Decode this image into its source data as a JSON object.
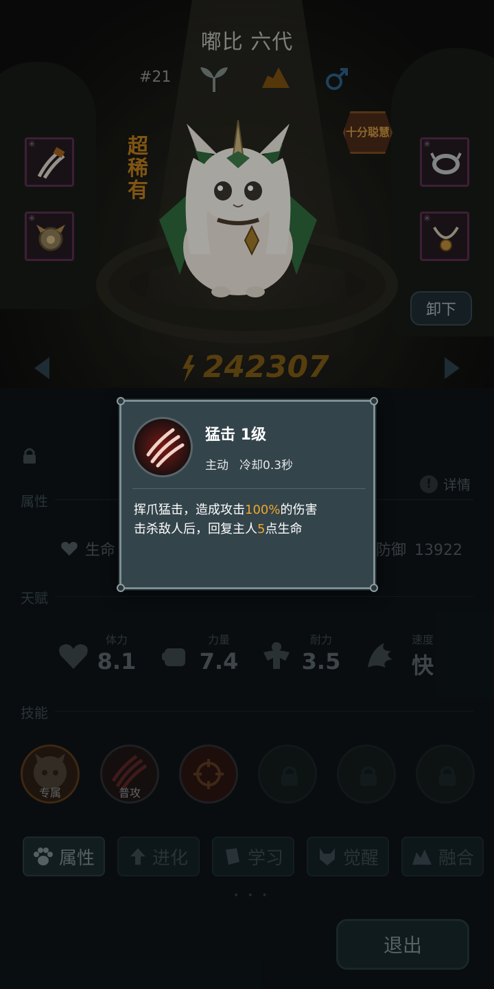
{
  "pet": {
    "name": "嘟比 六代",
    "number": "#21",
    "rarity": "超稀有",
    "wisdom_badge": "十分聪慧",
    "power": "242307",
    "unequip_label": "卸下",
    "icons": [
      "sprout-icon",
      "terrain-icon",
      "male-icon"
    ]
  },
  "equipment": {
    "slots": [
      {
        "name": "claw-equip",
        "icon": "claw-icon"
      },
      {
        "name": "helmet-equip",
        "icon": "helmet-icon"
      },
      {
        "name": "ring-equip",
        "icon": "ring-icon"
      },
      {
        "name": "necklace-equip",
        "icon": "necklace-icon"
      }
    ]
  },
  "detail_label": "详情",
  "sections": {
    "attributes": "属性",
    "talent": "天赋",
    "skills": "技能"
  },
  "attributes": {
    "life_label": "生命",
    "defense_label": "防御",
    "defense_value": "13922"
  },
  "talents": [
    {
      "label": "体力",
      "value": "8.1",
      "icon": "heart-icon"
    },
    {
      "label": "力量",
      "value": "7.4",
      "icon": "fist-icon"
    },
    {
      "label": "耐力",
      "value": "3.5",
      "icon": "muscle-icon"
    },
    {
      "label": "速度",
      "value": "快",
      "icon": "wing-icon"
    }
  ],
  "skills": [
    {
      "tag": "专属",
      "icon": "exclusive-skill-icon",
      "locked": false
    },
    {
      "tag": "普攻",
      "icon": "claw-strike-icon",
      "locked": false
    },
    {
      "tag": "",
      "icon": "target-icon",
      "locked": false
    },
    {
      "tag": "",
      "icon": "lock-icon",
      "locked": true
    },
    {
      "tag": "",
      "icon": "lock-icon",
      "locked": true
    },
    {
      "tag": "",
      "icon": "lock-icon",
      "locked": true
    }
  ],
  "tabs": [
    {
      "label": "属性",
      "icon": "paw-icon",
      "active": true
    },
    {
      "label": "进化",
      "icon": "arrow-up-icon",
      "active": false
    },
    {
      "label": "学习",
      "icon": "book-icon",
      "active": false
    },
    {
      "label": "觉醒",
      "icon": "awaken-icon",
      "active": false
    },
    {
      "label": "融合",
      "icon": "fusion-icon",
      "active": false
    }
  ],
  "pager_dots": "• • •",
  "exit_label": "退出",
  "popup": {
    "title": "猛击 1级",
    "type": "主动",
    "cooldown": "冷却0.3秒",
    "desc_line1_a": "挥爪猛击，造成攻击",
    "desc_line1_hl": "100%",
    "desc_line1_b": "的伤害",
    "desc_line2_a": "击杀敌人后，回复主人",
    "desc_line2_hl": "5",
    "desc_line2_b": "点生命",
    "icon": "claw-strike-icon",
    "highlight_color": "#f0a82a"
  }
}
